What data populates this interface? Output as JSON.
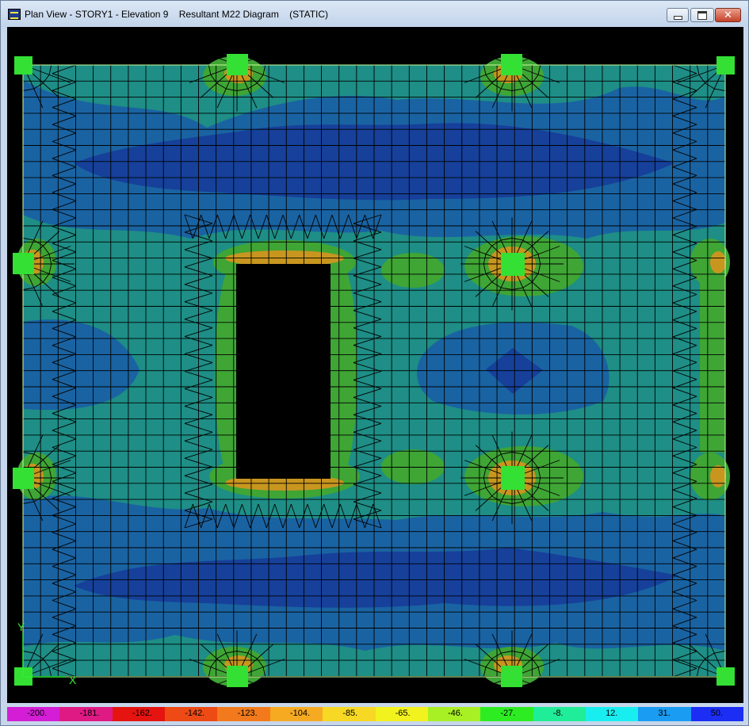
{
  "window": {
    "title": "Plan View - STORY1 - Elevation 9    Resultant M22 Diagram    (STATIC)"
  },
  "titlebar_buttons": {
    "close_glyph": "✕"
  },
  "axes_labels": {
    "y": "Y",
    "x": "X"
  },
  "colors": {
    "background": "#000000",
    "slab_base": "#1e8e86",
    "contour_mid": "#1a63a2",
    "contour_deep": "#16409a",
    "hot_green": "#3fc51f",
    "hot_orange": "#d98d16",
    "column": "#33e033",
    "grid_line": "#000000",
    "slab_edge": "#c8ff9a"
  },
  "legend": {
    "labels": [
      "-200.",
      "-181.",
      "-162.",
      "-142.",
      "-123.",
      "-104.",
      "-85.",
      "-65.",
      "-46.",
      "-27.",
      "-8.",
      "12.",
      "31.",
      "50."
    ],
    "colors": [
      "#d41ed6",
      "#e01a84",
      "#e51410",
      "#ee4a16",
      "#f37a1c",
      "#f6aa22",
      "#f7d824",
      "#f2f21f",
      "#a8ef24",
      "#2ded22",
      "#20ed98",
      "#18eef0",
      "#1a9cf2",
      "#1c2ef4"
    ]
  }
}
